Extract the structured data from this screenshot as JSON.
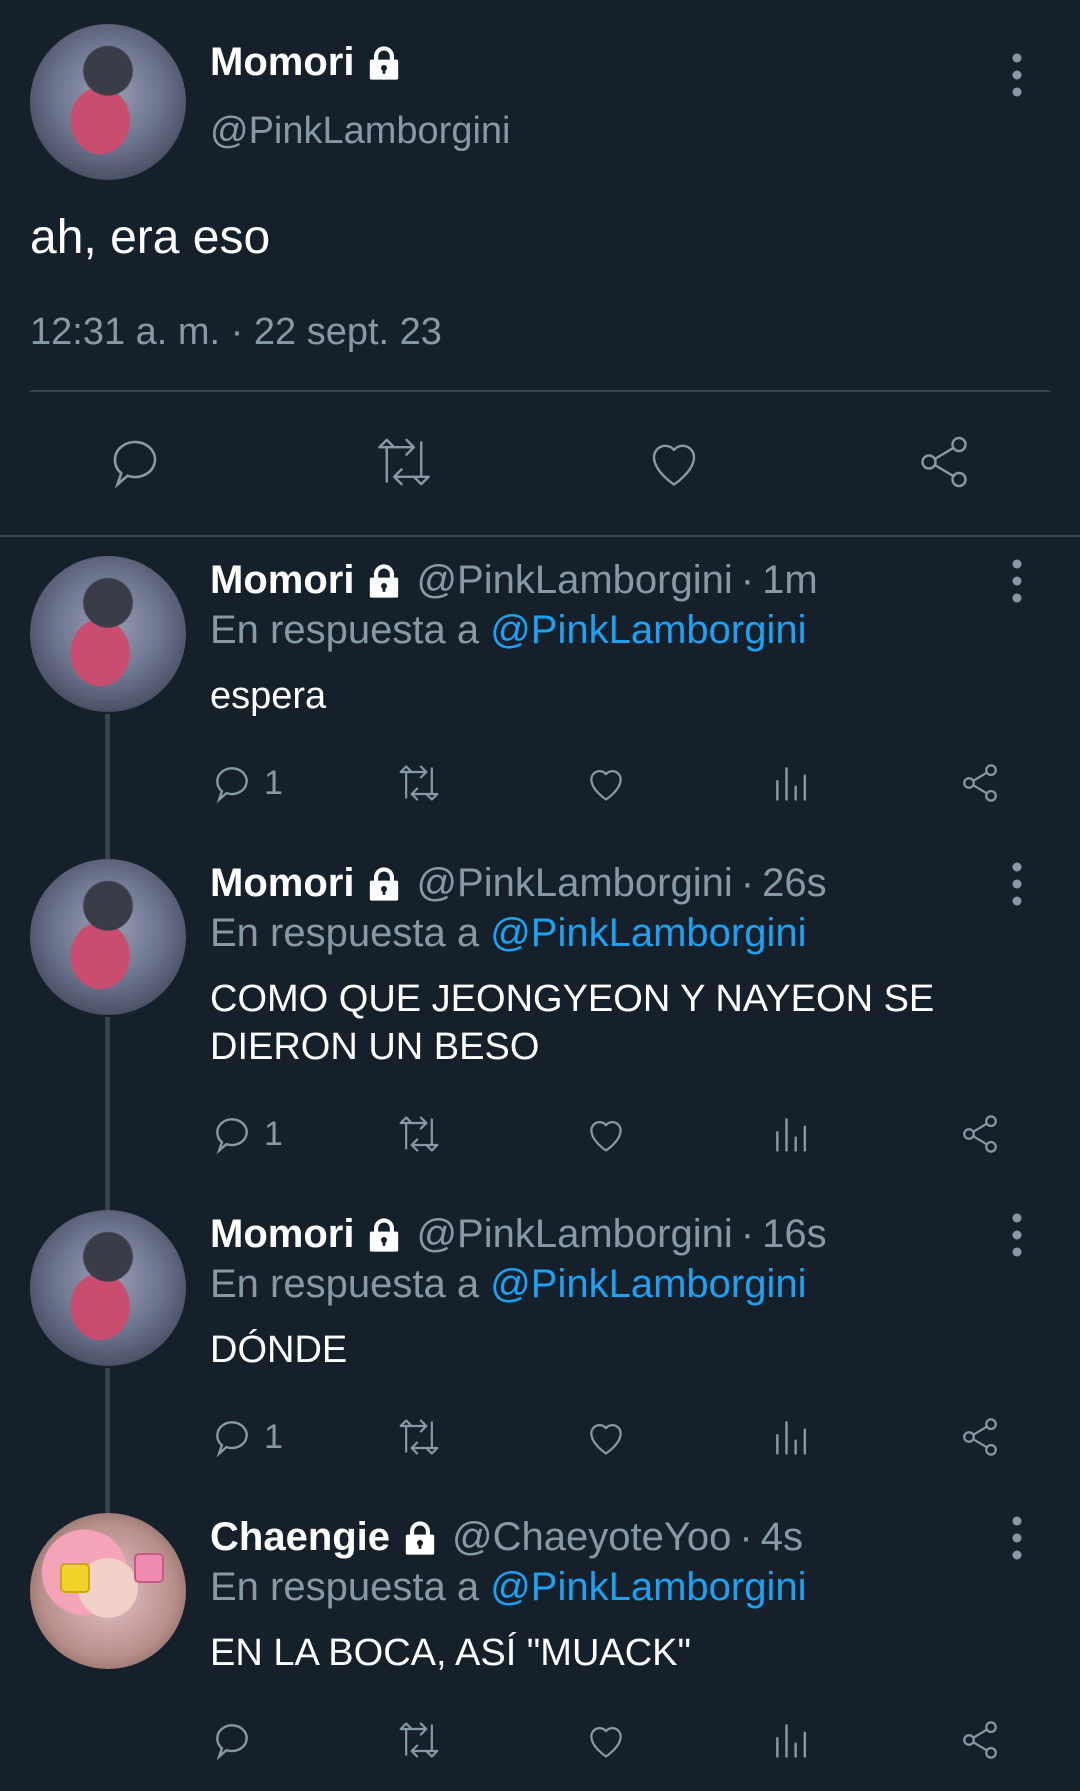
{
  "main_tweet": {
    "name": "Momori",
    "handle": "@PinkLamborgini",
    "text": "ah, era eso",
    "timestamp": "12:31 a. m. · 22 sept. 23",
    "actions": [
      "reply-icon",
      "retweet-icon",
      "like-icon",
      "share-icon"
    ]
  },
  "replies": [
    {
      "name": "Momori",
      "handle": "@PinkLamborgini",
      "time": "1m",
      "reply_prefix": "En respuesta a ",
      "mention": "@PinkLamborgini",
      "text": "espera",
      "reply_count": "1"
    },
    {
      "name": "Momori",
      "handle": "@PinkLamborgini",
      "time": "26s",
      "reply_prefix": "En respuesta a ",
      "mention": "@PinkLamborgini",
      "text": "COMO QUE JEONGYEON Y NAYEON SE DIERON UN BESO",
      "reply_count": "1"
    },
    {
      "name": "Momori",
      "handle": "@PinkLamborgini",
      "time": "16s",
      "reply_prefix": "En respuesta a ",
      "mention": "@PinkLamborgini",
      "text": "DÓNDE",
      "reply_count": "1"
    },
    {
      "name": "Chaengie",
      "handle": "@ChaeyoteYoo",
      "time": "4s",
      "reply_prefix": "En respuesta a ",
      "mention": "@PinkLamborgini",
      "text": "EN LA BOCA, ASÍ \"MUACK\"",
      "reply_count": ""
    }
  ],
  "separator": "·",
  "colors": {
    "background": "#15202b",
    "secondary_text": "#8899a6",
    "mention": "#1da1f2",
    "divider": "#38444d"
  }
}
